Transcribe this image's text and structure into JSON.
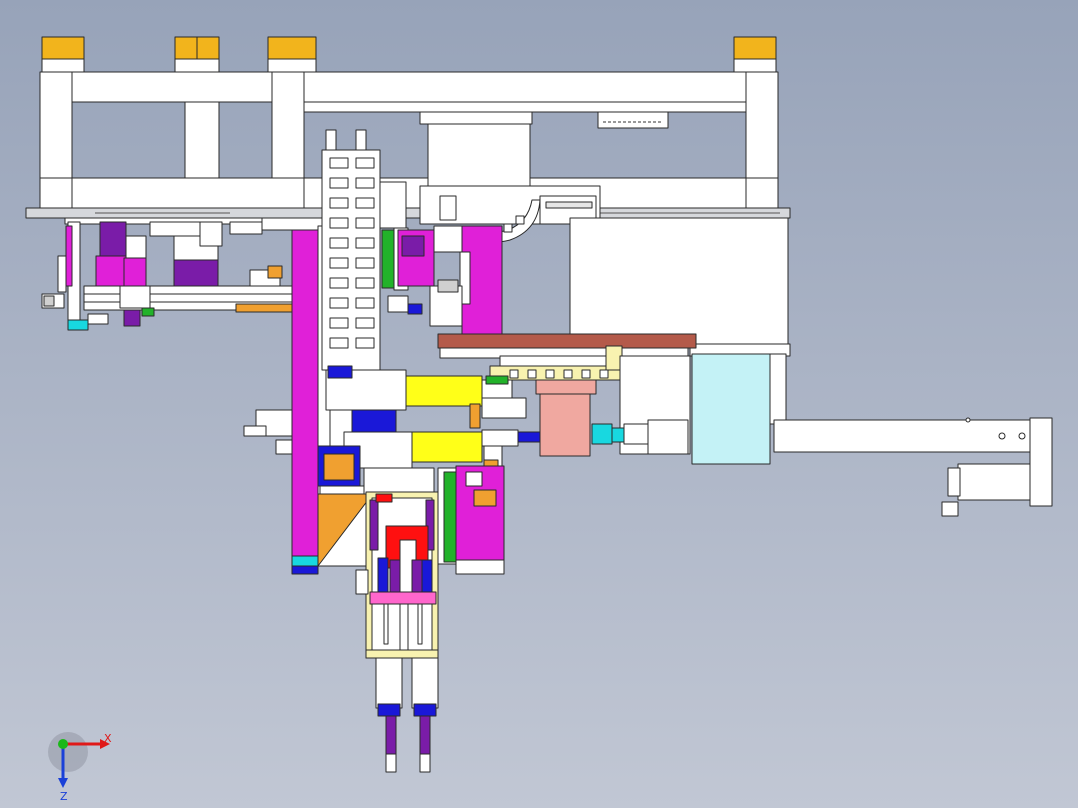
{
  "viewport": {
    "background_top": "#97a3b9",
    "background_bottom": "#c1c7d4"
  },
  "colors": {
    "frame": "#ffffff",
    "outline": "#2a2a2a",
    "pad": "#f2b41c",
    "magenta": "#e020d8",
    "purple": "#7a1ca8",
    "green": "#22b22a",
    "yellow": "#ffff18",
    "red": "#ff1010",
    "blue": "#1a18d8",
    "orange": "#f0a030",
    "brown": "#b45a4a",
    "salmon": "#f0a8a0",
    "cyan": "#18d8e0",
    "light_cyan": "#c4f2f6",
    "pale_yellow": "#f8f2b0",
    "grey": "#d2d4d8"
  },
  "triad": {
    "x_label": "X",
    "z_label": "Z",
    "x_color": "#e01818",
    "z_color": "#1a40d8",
    "origin_color": "#1ab818"
  }
}
